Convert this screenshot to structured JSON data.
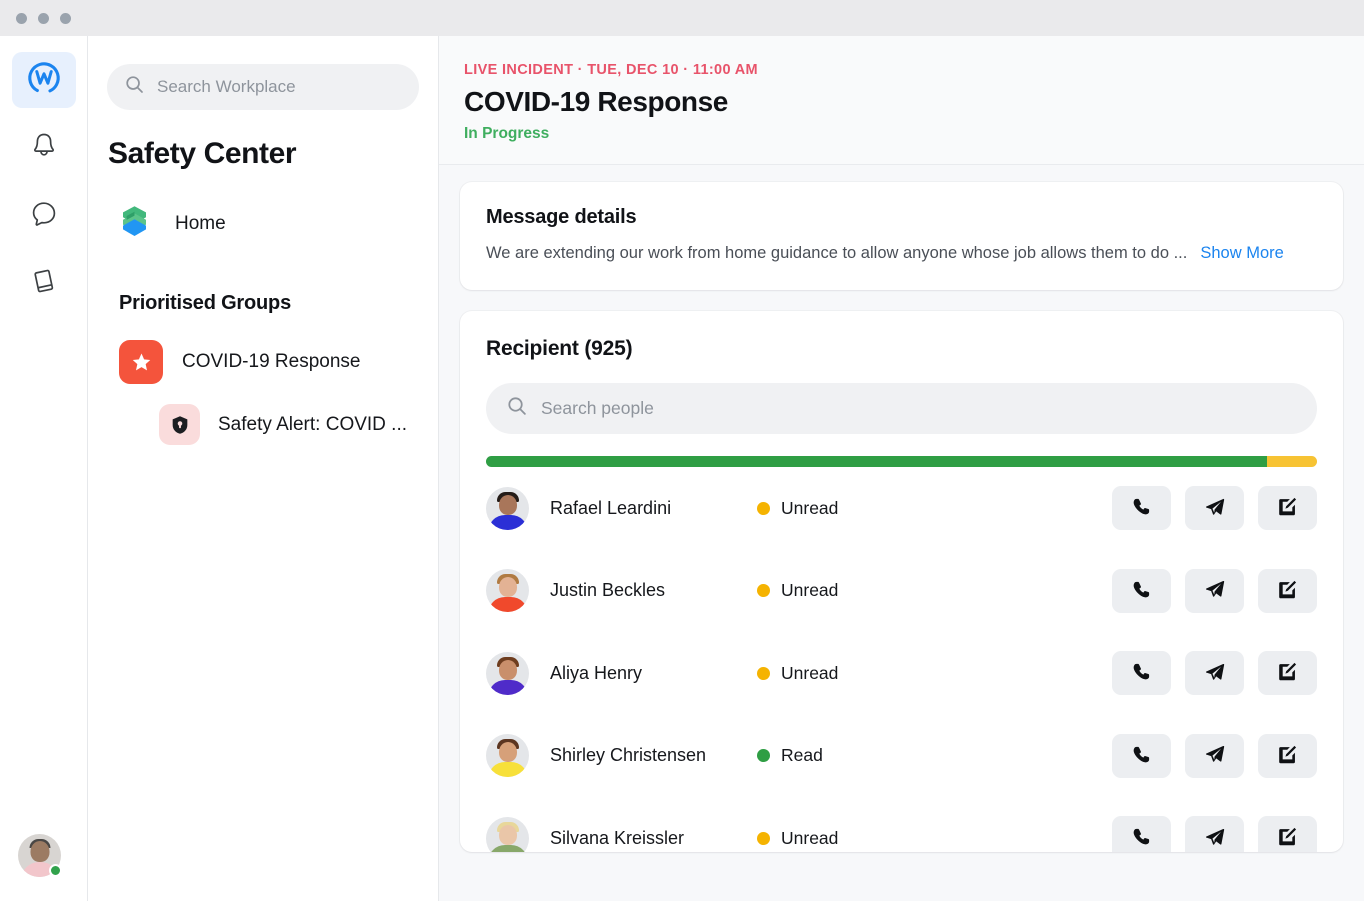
{
  "window": {
    "dots": [
      "close",
      "minimize",
      "maximize"
    ]
  },
  "rail": {
    "items": [
      {
        "name": "workplace-logo",
        "icon": "workplace-w-icon",
        "active": true
      },
      {
        "name": "notifications",
        "icon": "bell-icon",
        "active": false
      },
      {
        "name": "messages",
        "icon": "chat-bubble-icon",
        "active": false
      },
      {
        "name": "library",
        "icon": "book-icon",
        "active": false
      }
    ],
    "profile": {
      "icon": "avatar",
      "status": "online"
    }
  },
  "sidebar": {
    "search": {
      "placeholder": "Search Workplace",
      "value": ""
    },
    "title": "Safety Center",
    "home": {
      "label": "Home",
      "icon": "safety-center-logo"
    },
    "groups_heading": "Prioritised Groups",
    "groups": [
      {
        "label": "COVID-19 Response",
        "icon": "star-icon"
      }
    ],
    "sub_items": [
      {
        "label": "Safety Alert: COVID ...",
        "icon": "shield-icon"
      }
    ]
  },
  "header": {
    "eyebrow": "LIVE INCIDENT · TUE, DEC 10 · 11:00 AM",
    "title": "COVID-19 Response",
    "status": "In Progress",
    "eyebrow_color": "#e8536a",
    "status_color": "#3fae5f"
  },
  "message_details": {
    "title": "Message details",
    "text": "We are extending our work from home guidance to allow anyone whose job allows them to do ...",
    "show_more": "Show More",
    "link_color": "#1b84ef"
  },
  "recipients": {
    "title": "Recipient (925)",
    "count": 925,
    "search": {
      "placeholder": "Search people",
      "value": ""
    },
    "progress": {
      "read_percent": 94,
      "unread_percent": 6,
      "read_color": "#2f9e44",
      "unread_color": "#f7c333"
    },
    "rows": [
      {
        "name": "Rafael Leardini",
        "status": "Unread",
        "status_type": "unread",
        "avatar": {
          "skin": "#a9765a",
          "hair": "#241c18",
          "shirt": "#2b2fd6"
        }
      },
      {
        "name": "Justin Beckles",
        "status": "Unread",
        "status_type": "unread",
        "avatar": {
          "skin": "#e3b294",
          "hair": "#b07b43",
          "shirt": "#f0492c"
        }
      },
      {
        "name": "Aliya Henry",
        "status": "Unread",
        "status_type": "unread",
        "avatar": {
          "skin": "#c98f6b",
          "hair": "#6e3d1f",
          "shirt": "#4f2bc9"
        }
      },
      {
        "name": "Shirley Christensen",
        "status": "Read",
        "status_type": "read",
        "avatar": {
          "skin": "#d6a079",
          "hair": "#5b3520",
          "shirt": "#f7e03a"
        }
      },
      {
        "name": "Silvana Kreissler",
        "status": "Unread",
        "status_type": "unread",
        "avatar": {
          "skin": "#eac6a8",
          "hair": "#e8d79a",
          "shirt": "#88a86a"
        }
      }
    ],
    "actions": [
      {
        "name": "call-button",
        "icon": "phone-icon"
      },
      {
        "name": "send-button",
        "icon": "paper-plane-icon"
      },
      {
        "name": "compose-button",
        "icon": "edit-square-icon"
      }
    ]
  }
}
